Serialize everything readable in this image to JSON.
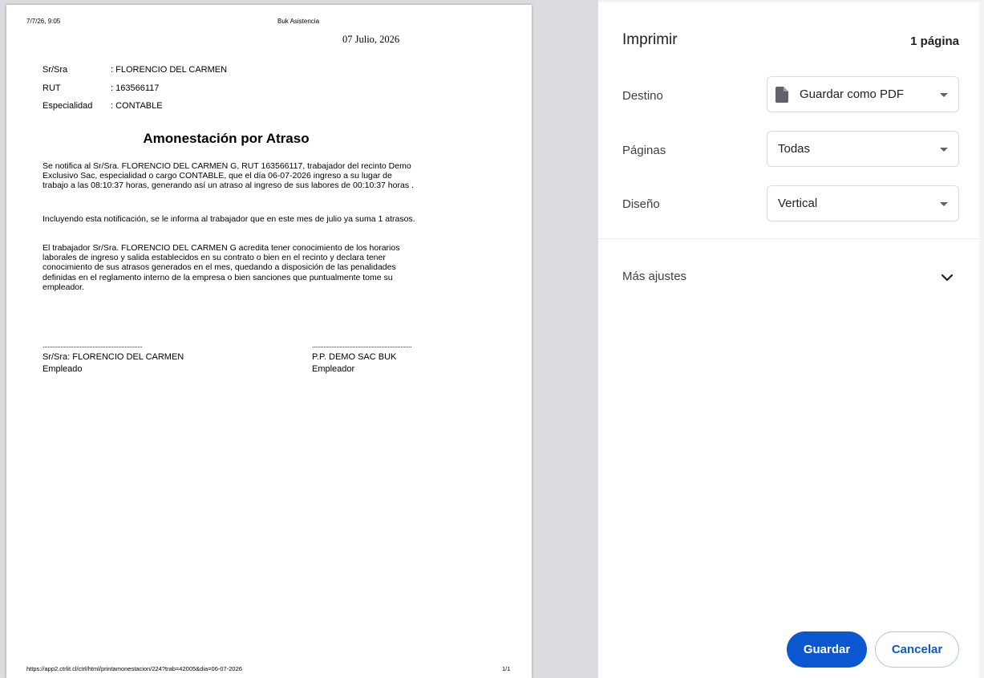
{
  "document": {
    "header_left": "7/7/26, 9:05",
    "header_center": "Buk Asistencia",
    "date": "07 Julio, 2026",
    "info": [
      {
        "label": "Sr/Sra",
        "value": ": FLORENCIO DEL CARMEN"
      },
      {
        "label": "RUT",
        "value": ": 163566117"
      },
      {
        "label": "Especialidad",
        "value": ": CONTABLE"
      }
    ],
    "title": "Amonestación por Atraso",
    "paragraphs": [
      "Se notifica al Sr/Sra. FLORENCIO DEL CARMEN G, RUT 163566117, trabajador del recinto Demo Exclusivo Sac, especialidad o cargo CONTABLE, que el día 06-07-2026 ingreso a su lugar de trabajo a las 08:10:37 horas, generando así un atraso al ingreso de sus labores de 00:10:37 horas .",
      "Incluyendo esta notificación, se le informa al trabajador que en este mes de julio ya suma 1 atrasos.",
      "El trabajador Sr/Sra. FLORENCIO DEL CARMEN G acredita tener conocimiento de los horarios laborales de ingreso y salida establecidos en su contrato o bien en el recinto y declara tener conocimiento de sus atrasos generados en el mes, quedando a disposición de las penalidades definidas en el reglamento interno de la empresa o bien sanciones que puntualmente tome su empleador."
    ],
    "signature_dots": "..............................................................",
    "signature_left": {
      "name": "Sr/Sra: FLORENCIO DEL CARMEN",
      "role": "Empleado"
    },
    "signature_right": {
      "name": "P.P. DEMO SAC BUK",
      "role": "Empleador"
    },
    "footer_url": "https://app2.ctrlit.cl/ctrl/html/printamonestacion/224?trab=42005&dia=06-07-2026",
    "footer_page": "1/1"
  },
  "panel": {
    "title": "Imprimir",
    "page_count": "1 página",
    "destination": {
      "label": "Destino",
      "value": "Guardar como PDF",
      "icon": "file-icon"
    },
    "pages": {
      "label": "Páginas",
      "value": "Todas"
    },
    "layout": {
      "label": "Diseño",
      "value": "Vertical"
    },
    "more_settings": {
      "label": "Más ajustes",
      "icon": "chevron-down-icon"
    },
    "save_label": "Guardar",
    "cancel_label": "Cancelar"
  },
  "colors": {
    "accent": "#0b57d0",
    "preview_background": "#dadce0"
  }
}
